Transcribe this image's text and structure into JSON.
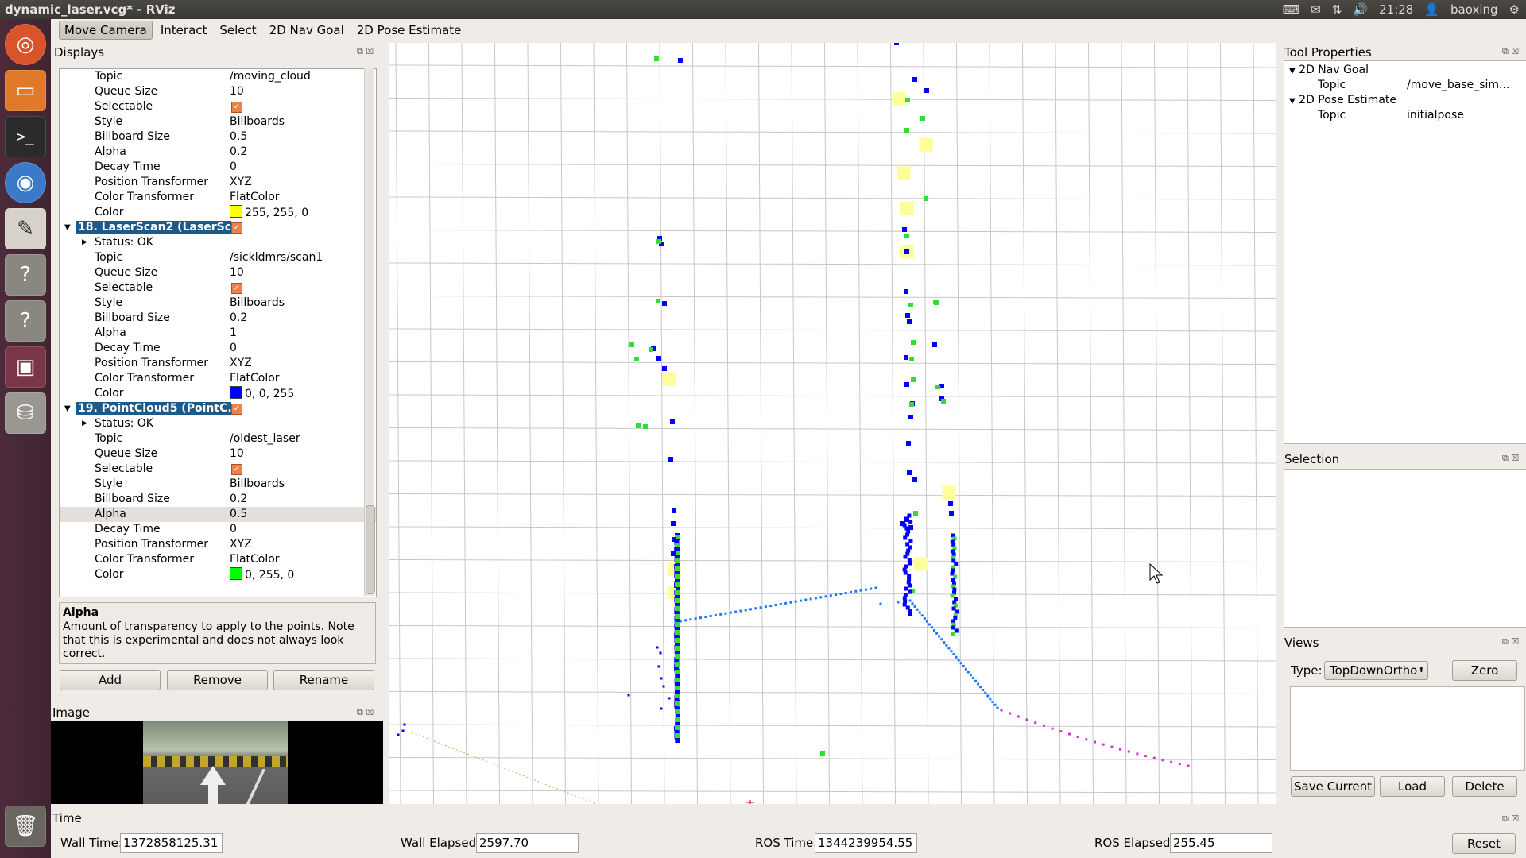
{
  "window": {
    "title": "dynamic_laser.vcg* - RViz",
    "clock": "21:28",
    "user": "baoxing"
  },
  "toolbar": {
    "tools": [
      "Move Camera",
      "Interact",
      "Select",
      "2D Nav Goal",
      "2D Pose Estimate"
    ]
  },
  "displays": {
    "title": "Displays",
    "rows": [
      {
        "type": "prop",
        "key": "Topic",
        "value": "/moving_cloud"
      },
      {
        "type": "prop",
        "key": "Queue Size",
        "value": "10"
      },
      {
        "type": "check",
        "key": "Selectable"
      },
      {
        "type": "prop",
        "key": "Style",
        "value": "Billboards"
      },
      {
        "type": "prop",
        "key": "Billboard Size",
        "value": "0.5"
      },
      {
        "type": "prop",
        "key": "Alpha",
        "value": "0.2"
      },
      {
        "type": "prop",
        "key": "Decay Time",
        "value": "0"
      },
      {
        "type": "prop",
        "key": "Position Transformer",
        "value": "XYZ"
      },
      {
        "type": "prop",
        "key": "Color Transformer",
        "value": "FlatColor"
      },
      {
        "type": "color",
        "key": "Color",
        "value": "255, 255, 0",
        "color": "#ffff00"
      },
      {
        "type": "header",
        "key": "18. LaserScan2 (LaserSc..."
      },
      {
        "type": "status",
        "key": "Status: OK"
      },
      {
        "type": "prop",
        "key": "Topic",
        "value": "/sickldmrs/scan1"
      },
      {
        "type": "prop",
        "key": "Queue Size",
        "value": "10"
      },
      {
        "type": "check",
        "key": "Selectable"
      },
      {
        "type": "prop",
        "key": "Style",
        "value": "Billboards"
      },
      {
        "type": "prop",
        "key": "Billboard Size",
        "value": "0.2"
      },
      {
        "type": "prop",
        "key": "Alpha",
        "value": "1"
      },
      {
        "type": "prop",
        "key": "Decay Time",
        "value": "0"
      },
      {
        "type": "prop",
        "key": "Position Transformer",
        "value": "XYZ"
      },
      {
        "type": "prop",
        "key": "Color Transformer",
        "value": "FlatColor"
      },
      {
        "type": "color",
        "key": "Color",
        "value": "0, 0, 255",
        "color": "#0000ff"
      },
      {
        "type": "header",
        "key": "19. PointCloud5 (PointC..."
      },
      {
        "type": "status",
        "key": "Status: OK"
      },
      {
        "type": "prop",
        "key": "Topic",
        "value": "/oldest_laser"
      },
      {
        "type": "prop",
        "key": "Queue Size",
        "value": "10"
      },
      {
        "type": "check",
        "key": "Selectable"
      },
      {
        "type": "prop",
        "key": "Style",
        "value": "Billboards"
      },
      {
        "type": "prop",
        "key": "Billboard Size",
        "value": "0.2"
      },
      {
        "type": "prop",
        "key": "Alpha",
        "value": "0.5",
        "selected": true
      },
      {
        "type": "prop",
        "key": "Decay Time",
        "value": "0"
      },
      {
        "type": "prop",
        "key": "Position Transformer",
        "value": "XYZ"
      },
      {
        "type": "prop",
        "key": "Color Transformer",
        "value": "FlatColor"
      },
      {
        "type": "color",
        "key": "Color",
        "value": "0, 255, 0",
        "color": "#00ff00"
      }
    ],
    "description_title": "Alpha",
    "description": "Amount of transparency to apply to the points. Note that this is experimental and does not always look correct.",
    "buttons": {
      "add": "Add",
      "remove": "Remove",
      "rename": "Rename"
    }
  },
  "image_panel": {
    "title": "Image"
  },
  "tool_properties": {
    "title": "Tool Properties",
    "items": [
      {
        "name": "2D Nav Goal",
        "topic_label": "Topic",
        "topic": "/move_base_sim..."
      },
      {
        "name": "2D Pose Estimate",
        "topic_label": "Topic",
        "topic": "initialpose"
      }
    ]
  },
  "selection": {
    "title": "Selection"
  },
  "views": {
    "title": "Views",
    "type_label": "Type:",
    "type_value": "TopDownOrtho",
    "zero": "Zero",
    "save": "Save Current",
    "load": "Load",
    "delete": "Delete"
  },
  "time": {
    "title": "Time",
    "wall_time_label": "Wall Time:",
    "wall_time": "1372858125.31",
    "wall_elapsed_label": "Wall Elapsed:",
    "wall_elapsed": "2597.70",
    "ros_time_label": "ROS Time:",
    "ros_time": "1344239954.55",
    "ros_elapsed_label": "ROS Elapsed:",
    "ros_elapsed": "255.45",
    "reset": "Reset"
  },
  "colors": {
    "grid": "#c8c8c8",
    "laser_scan": "#0000ff",
    "point_cloud": "#33dd33",
    "moving_cloud": "#ffff99",
    "path": "#1e78ff",
    "path2": "#cc33cc",
    "header_bg": "#1c5a8c"
  }
}
